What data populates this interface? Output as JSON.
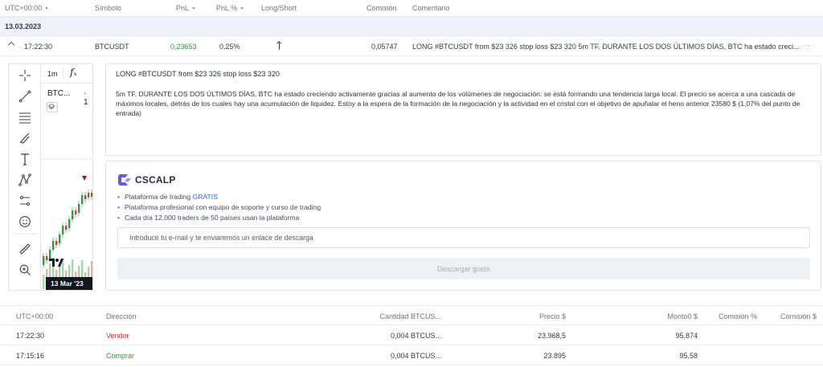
{
  "table_header": {
    "timezone": "UTC+00:00",
    "symbol": "Símbolo",
    "pnl": "PnL",
    "pnl_pct": "PnL %",
    "long_short": "Long/Short",
    "commission": "Comisión",
    "comment": "Comentario"
  },
  "date_group": "13.03.2023",
  "trade": {
    "time": "17:22:30",
    "symbol": "BTCUSDT",
    "pnl": "0,23653",
    "pnl_pct": "0,25%",
    "direction_icon": "arrow-up-icon",
    "commission": "0,05747",
    "comment": "LONG #BTCUSDT from $23 326 stop loss $23 320 5m TF. DURANTE LOS DOS ÚLTIMOS DÍAS, BTC ha estado creci..."
  },
  "chart": {
    "interval": "1m",
    "fx_label": "fₓ",
    "symbol": "BTC...",
    "symbol_suffix": "· 1",
    "date_label": "13 Mar '23",
    "tools": [
      "crosshair-icon",
      "trend-line-icon",
      "fib-icon",
      "brush-icon",
      "text-icon",
      "pattern-icon",
      "measure-icon",
      "emoji-icon",
      "ruler-icon",
      "zoom-icon"
    ]
  },
  "description": {
    "title": "LONG #BTCUSDT from $23 326 stop loss $23 320",
    "body": "5m TF. DURANTE LOS DOS ÚLTIMOS DÍAS, BTC ha estado creciendo activamente gracias al aumento de los volúmenes de negociación: se está formando una tendencia larga local. El precio se acerca a una cascada de máximos locales, detrás de los cuales hay una acumulación de liquidez. Estoy a la espera de la formación de la negociación y la actividad en el cristal con el objetivo de apuñalar el heno anterior 23580 $ (1,07% del punto de entrada)"
  },
  "promo": {
    "brand": "CSCALP",
    "item1_prefix": "Plataforma de trading ",
    "item1_link": "GRATIS",
    "item2": "Plataforma profesional con equipo de soporte y curso de trading",
    "item3": "Cada día 12,000 traders de 50 países usan la plataforma",
    "email_placeholder": "Introduce tu e-mail y te enviaremos un enlace de descarga",
    "download_label": "Descargar gratis",
    "accent": "#6a57e8"
  },
  "fills_header": {
    "timezone": "UTC+00:00",
    "direction": "Dirección",
    "quantity": "Cantidad BTCUS...",
    "price": "Precio $",
    "amount": "Monto0 $",
    "commission_pct": "Comisión %",
    "commission": "Comisión $"
  },
  "fills": [
    {
      "time": "17:22:30",
      "direction": "Vender",
      "quantity": "0,004 BTCUS...",
      "price": "23.968,5",
      "amount": "95,874"
    },
    {
      "time": "17:15:16",
      "direction": "Comprar",
      "quantity": "0,004 BTCUS...",
      "price": "23.895",
      "amount": "95,58"
    }
  ],
  "colors": {
    "sell": "#e0382f",
    "buy": "#21a33a",
    "link": "#2f6bd8"
  }
}
